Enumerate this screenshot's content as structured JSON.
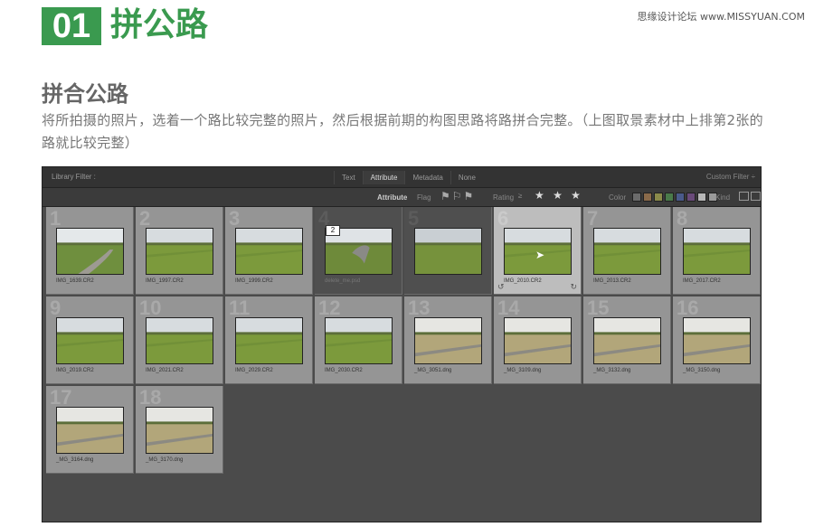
{
  "header": {
    "number": "01",
    "title": "拼公路",
    "watermark": "思缘设计论坛 www.MISSYUAN.COM"
  },
  "section": {
    "subtitle": "拼合公路",
    "paragraph": "将所拍摄的照片，选着一个路比较完整的照片，然后根据前期的构图思路将路拼合完整。（上图取景素材中上排第2张的路就比较完整）"
  },
  "lightroom": {
    "filter_label": "Library Filter :",
    "tabs": [
      "Text",
      "Attribute",
      "Metadata",
      "None"
    ],
    "active_tab": "Attribute",
    "custom_filter": "Custom Filter ÷",
    "bar": {
      "attribute": "Attribute",
      "flag": "Flag",
      "rating": "Rating",
      "rating_icon": "≥",
      "stars": "★ ★ ★",
      "color": "Color",
      "kind": "Kind"
    },
    "color_swatches": [
      "#6b6b6b",
      "#8a6a4a",
      "#8a8a4a",
      "#4a7a4a",
      "#4a5a8a",
      "#6a4a7a",
      "#b8b8b8",
      "#9a9a9a"
    ],
    "stack_count": "2",
    "cells": [
      {
        "index": "1",
        "file": "IMG_1639.CR2",
        "state": "normal",
        "scene": "road"
      },
      {
        "index": "2",
        "file": "IMG_1997.CR2",
        "state": "normal",
        "scene": "field"
      },
      {
        "index": "3",
        "file": "IMG_1999.CR2",
        "state": "normal",
        "scene": "field"
      },
      {
        "index": "4",
        "file": "delete_me.psd",
        "state": "dark",
        "scene": "stack"
      },
      {
        "index": "5",
        "file": "",
        "state": "dark",
        "scene": "grass"
      },
      {
        "index": "6",
        "file": "IMG_2010.CR2",
        "state": "selected",
        "scene": "field"
      },
      {
        "index": "7",
        "file": "IMG_2013.CR2",
        "state": "normal",
        "scene": "field"
      },
      {
        "index": "8",
        "file": "IMG_2017.CR2",
        "state": "normal",
        "scene": "field"
      },
      {
        "index": "9",
        "file": "IMG_2019.CR2",
        "state": "normal",
        "scene": "field"
      },
      {
        "index": "10",
        "file": "IMG_2021.CR2",
        "state": "normal",
        "scene": "field"
      },
      {
        "index": "11",
        "file": "IMG_2029.CR2",
        "state": "normal",
        "scene": "field"
      },
      {
        "index": "12",
        "file": "IMG_2030.CR2",
        "state": "normal",
        "scene": "field"
      },
      {
        "index": "13",
        "file": "_MG_3051.dng",
        "state": "normal",
        "scene": "dry"
      },
      {
        "index": "14",
        "file": "_MG_3109.dng",
        "state": "normal",
        "scene": "dry"
      },
      {
        "index": "15",
        "file": "_MG_3132.dng",
        "state": "normal",
        "scene": "dry"
      },
      {
        "index": "16",
        "file": "_MG_3150.dng",
        "state": "normal",
        "scene": "dry"
      },
      {
        "index": "17",
        "file": "_MG_3164.dng",
        "state": "normal",
        "scene": "dry"
      },
      {
        "index": "18",
        "file": "_MG_3170.dng",
        "state": "normal",
        "scene": "dry"
      }
    ]
  }
}
